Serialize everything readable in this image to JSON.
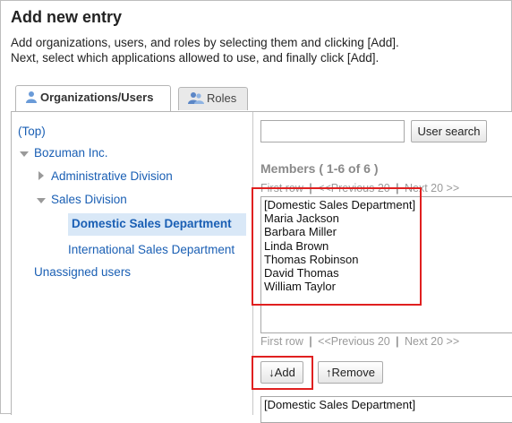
{
  "header": {
    "title": "Add new entry",
    "description_line1": "Add organizations, users, and roles by selecting them and clicking [Add].",
    "description_line2": "Next, select which applications allowed to use, and finally click [Add]."
  },
  "tabs": [
    {
      "label": "Organizations/Users",
      "icon": "users-icon",
      "active": true
    },
    {
      "label": "Roles",
      "icon": "roles-icon",
      "active": false
    }
  ],
  "tree": {
    "top": "(Top)",
    "company": "Bozuman Inc.",
    "admin_division": "Administrative Division",
    "sales_division": "Sales Division",
    "domestic_sales": "Domestic Sales Department",
    "international_sales": "International Sales Department",
    "unassigned": "Unassigned users"
  },
  "search": {
    "value": "",
    "button_label": "User search"
  },
  "members": {
    "title": "Members ( 1-6 of 6 )",
    "pager": {
      "first": "First row",
      "separator": "|",
      "previous": "<<Previous 20",
      "next": "Next 20 >>"
    },
    "items": [
      "[Domestic Sales Department]",
      "Maria Jackson",
      "Barbara Miller",
      "Linda Brown",
      "Thomas Robinson",
      "David Thomas",
      "William Taylor"
    ]
  },
  "actions": {
    "add_label": "↓Add",
    "remove_label": "↑Remove"
  },
  "selected_list": {
    "items": [
      "[Domestic Sales Department]"
    ]
  },
  "colors": {
    "link": "#1a5fb4",
    "highlight_box": "#e02020",
    "selected_node_bg": "#d9e8f7"
  }
}
